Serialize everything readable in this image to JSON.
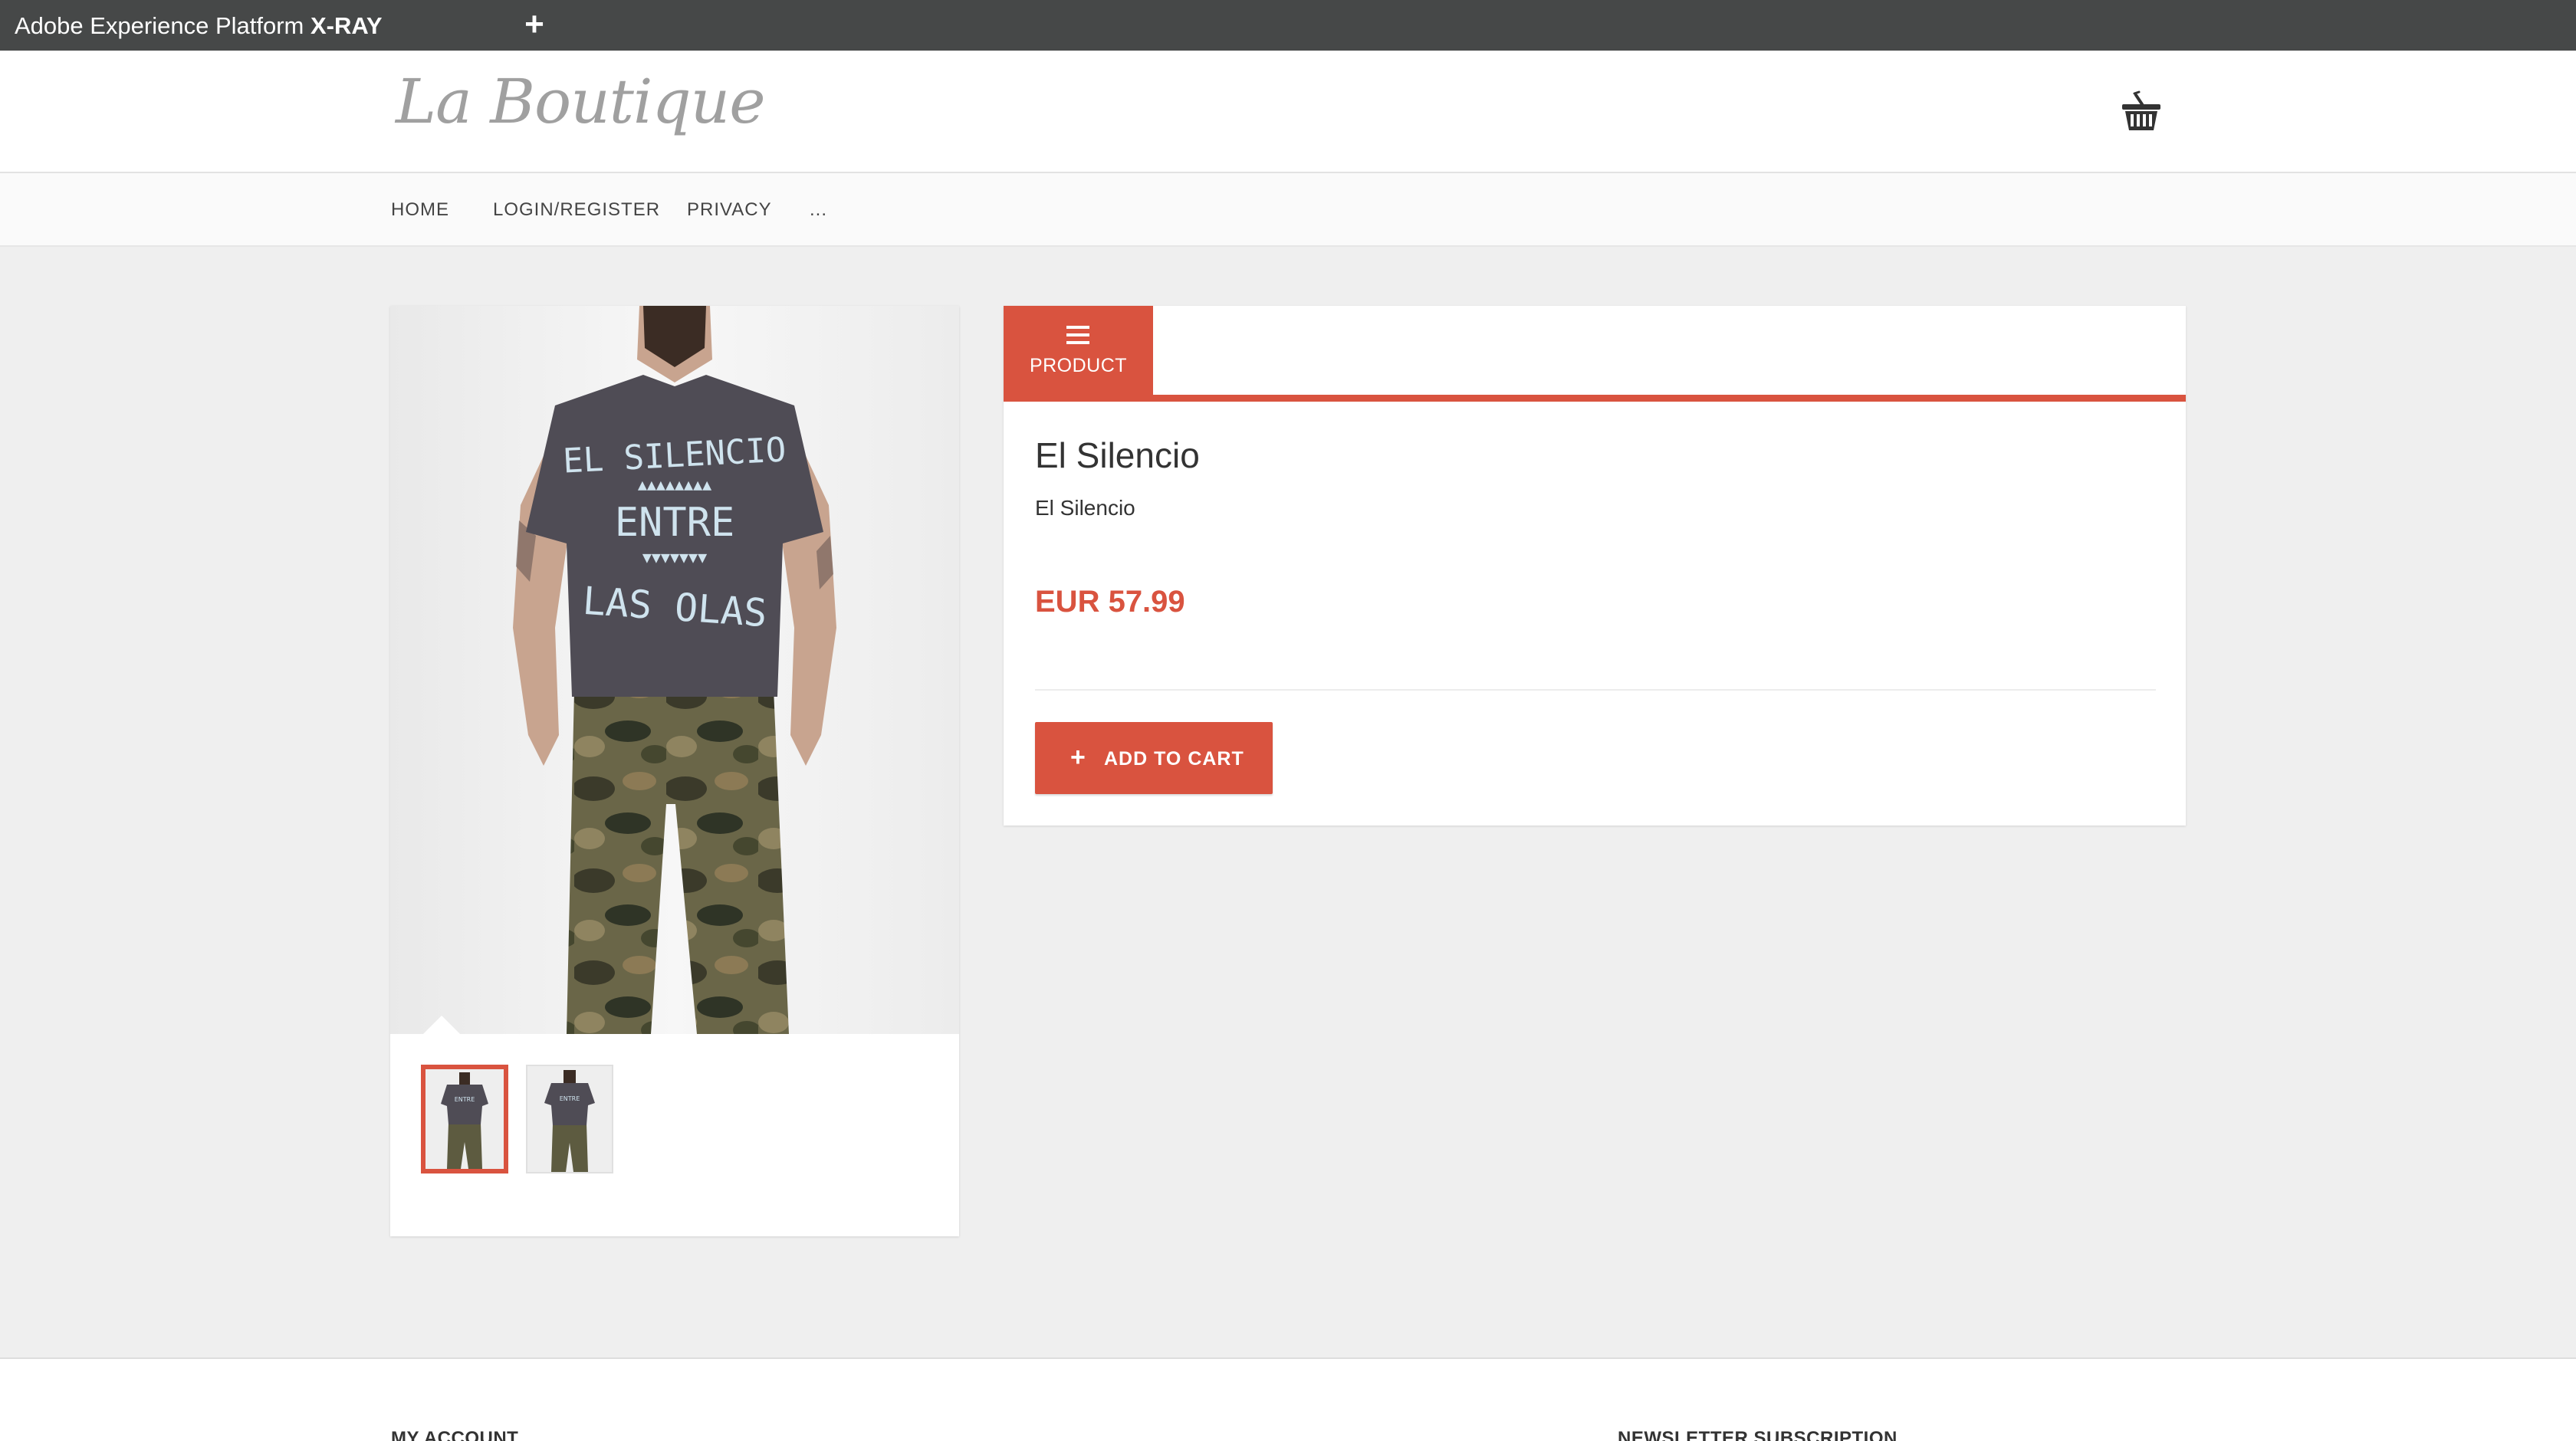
{
  "xray": {
    "title_prefix": "Adobe Experience Platform ",
    "title_bold": "X-RAY",
    "add_tab": "+"
  },
  "header": {
    "logo": "La Boutique",
    "cart_icon": "basket-icon"
  },
  "nav": {
    "items": [
      "HOME",
      "LOGIN/REGISTER",
      "PRIVACY",
      "..."
    ]
  },
  "gallery": {
    "main_image": "model-wearing-el-silencio-tshirt",
    "shirt_text": [
      "EL SILENCIO",
      "ENTRE",
      "LAS OLAS"
    ],
    "thumbnails": [
      "front-view",
      "back-view"
    ],
    "selected_thumbnail": 0
  },
  "product": {
    "tab_label": "PRODUCT",
    "tab_icon": "menu-icon",
    "title": "El Silencio",
    "description": "El Silencio",
    "price": "EUR 57.99",
    "add_to_cart_icon": "plus-icon",
    "add_to_cart_label": "ADD TO CART"
  },
  "footer": {
    "my_account": "MY ACCOUNT",
    "newsletter": "NEWSLETTER SUBSCRIPTION"
  },
  "colors": {
    "accent": "#d9533f",
    "xray_bar": "#464848",
    "page_bg": "#efefef"
  }
}
